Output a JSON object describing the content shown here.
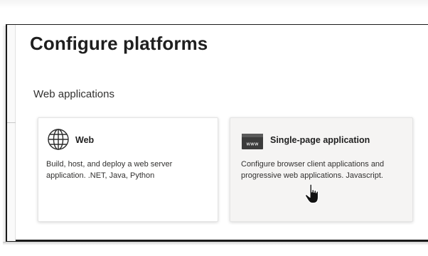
{
  "dialog": {
    "title": "Configure platforms"
  },
  "section": {
    "label": "Web applications"
  },
  "platforms": [
    {
      "name": "Web",
      "icon": "globe-icon",
      "description": "Build, host, and deploy a web server application. .NET, Java, Python",
      "state": "default"
    },
    {
      "name": "Single-page application",
      "icon": "www-browser-icon",
      "description": "Configure browser client applications and progressive web applications. Javascript.",
      "state": "hovered"
    }
  ],
  "icons": {
    "www_text": "www"
  },
  "colors": {
    "card_hover_bg": "#f5f4f3",
    "card_bg": "#ffffff",
    "text_primary": "#1f1f1f",
    "text_secondary": "#323130"
  }
}
